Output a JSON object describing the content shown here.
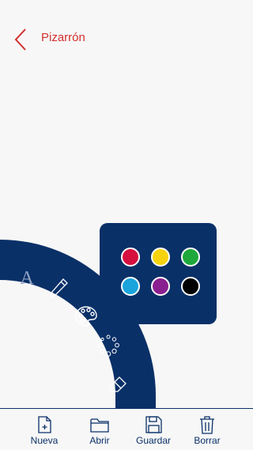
{
  "header": {
    "title": "Pizarrón",
    "back_icon": "chevron-left-icon"
  },
  "colors": {
    "accent": "#d32f2f",
    "navy": "#0a3068",
    "background": "#f7f7f7"
  },
  "tools": [
    {
      "icon": "text-icon",
      "glyph": "A"
    },
    {
      "icon": "pencil-icon"
    },
    {
      "icon": "palette-icon"
    },
    {
      "icon": "brush-size-icon"
    },
    {
      "icon": "eraser-icon"
    }
  ],
  "palette": {
    "colors": [
      "#d5103f",
      "#f6d30e",
      "#1ea83c",
      "#1ba3dc",
      "#8a1f8f",
      "#000000"
    ]
  },
  "toolbar": {
    "items": [
      {
        "label": "Nueva",
        "icon": "new-file-icon"
      },
      {
        "label": "Abrir",
        "icon": "folder-icon"
      },
      {
        "label": "Guardar",
        "icon": "save-icon"
      },
      {
        "label": "Borrar",
        "icon": "trash-icon"
      }
    ]
  }
}
